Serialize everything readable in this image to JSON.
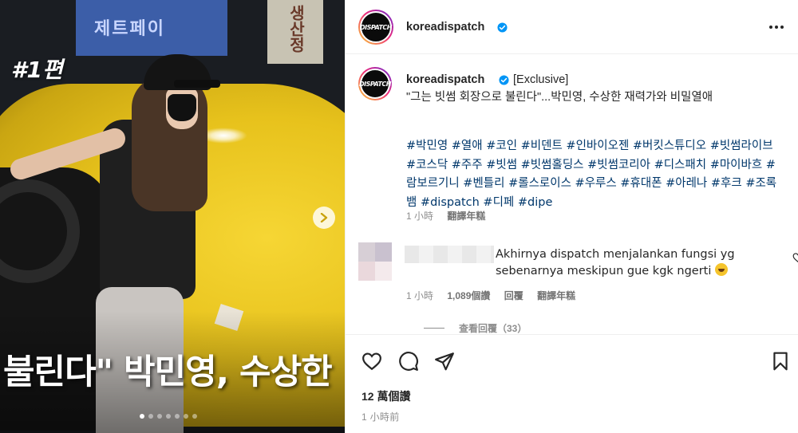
{
  "media": {
    "episode_label": "#1편",
    "overlay_caption": "불린다\" 박민영, 수상한",
    "background_sign_text": "제트페이",
    "background_sign_text_2": "생산정",
    "carousel": {
      "total": 7,
      "active_index": 0
    }
  },
  "header": {
    "username": "koreadispatch",
    "avatar_logo": "DISPATCH"
  },
  "post": {
    "username": "koreadispatch",
    "exclusive_tag": "[Exclusive]",
    "headline": "\"그는 빗썸 회장으로 불린다\"...박민영, 수상한 재력가와 비밀열애",
    "hashtags": "#박민영 #열애 #코인 #비덴트 #인바이오젠 #버킷스튜디오 #빗썸라이브 #코스닥 #주주 #빗썸 #빗썸홀딩스 #빗썸코리아 #디스패치 #마이바흐 #람보르기니 #벤틀리 #롤스로이스 #우루스 #휴대폰 #아레나 #후크 #조록뱀 #dispatch #디페 #dipe",
    "time": "1 小時",
    "translate_label": "翻譯年糕"
  },
  "comment": {
    "text": "Akhirnya dispatch menjalankan fungsi yg sebenarnya meskipun gue kgk ngerti",
    "time": "1 小時",
    "likes": "1,089個讚",
    "reply_label": "回覆",
    "translate_label": "翻譯年糕",
    "view_replies": "查看回覆（33）"
  },
  "actions": {
    "likes_count": "12 萬個讚",
    "time_ago": "1 小時前"
  },
  "colors": {
    "hashtag": "#00376b",
    "verified": "#0095f6",
    "text_primary": "#262626",
    "text_secondary": "#8e8e8e"
  }
}
